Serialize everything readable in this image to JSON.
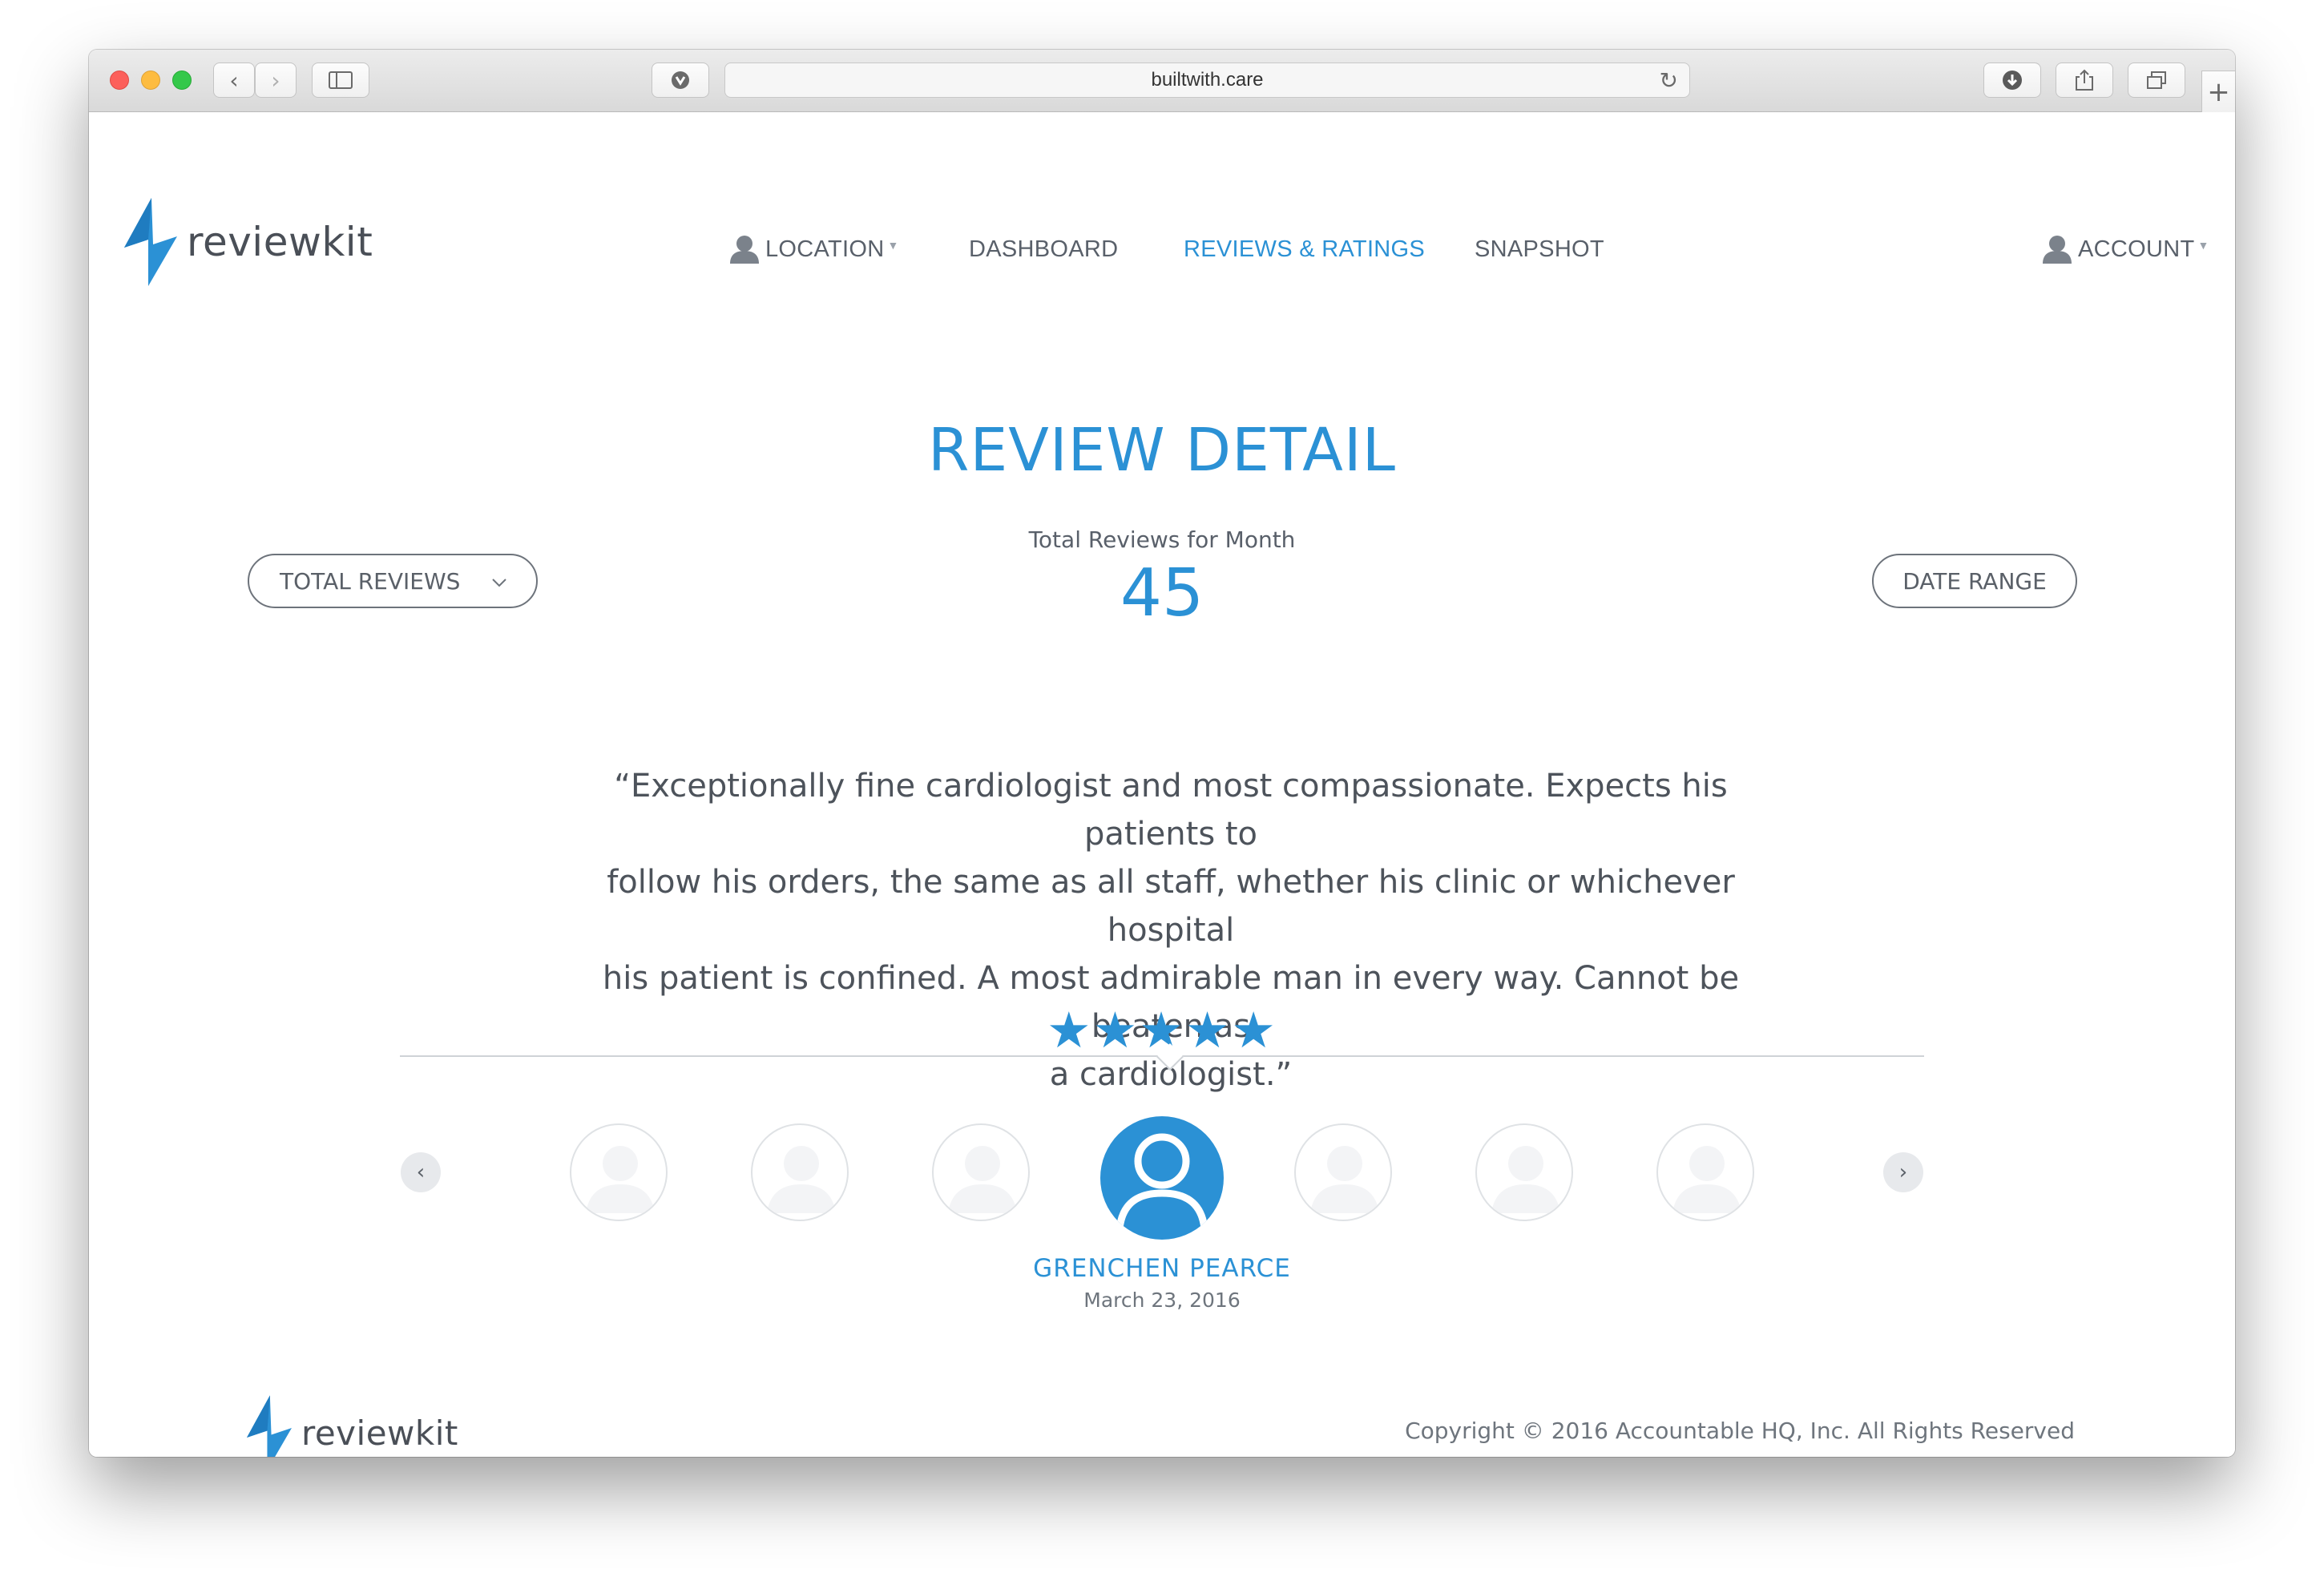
{
  "browser": {
    "url": "builtwith.care"
  },
  "header": {
    "logo_text": "reviewkit",
    "nav": [
      {
        "label": "LOCATION",
        "has_dropdown": true
      },
      {
        "label": "DASHBOARD"
      },
      {
        "label": "REVIEWS & RATINGS",
        "active": true
      },
      {
        "label": "SNAPSHOT"
      }
    ],
    "account_label": "ACCOUNT"
  },
  "main": {
    "title": "REVIEW DETAIL",
    "total_reviews_filter": "TOTAL REVIEWS",
    "date_range_button": "DATE RANGE",
    "stat_label": "Total Reviews for Month",
    "stat_value": "45",
    "review": {
      "quote_lines": [
        "“Exceptionally fine cardiologist and most compassionate. Expects his patients to",
        "follow his orders, the same as all staff, whether his clinic or whichever hospital",
        "his patient is confined. A most admirable man in every way. Cannot be beaten as",
        "a cardiologist.”"
      ],
      "rating": 5,
      "rating_max": 5,
      "stars": "★★★★★",
      "reviewer_name": "GRENCHEN PEARCE",
      "date": "March 23, 2016"
    },
    "carousel": {
      "prev_icon": "‹",
      "next_icon": "›"
    }
  },
  "footer": {
    "logo_text": "reviewkit",
    "copyright": "Copyright © 2016 Accountable HQ, Inc. All Rights Reserved"
  },
  "colors": {
    "accent": "#2b91d5",
    "text": "#59606a"
  }
}
